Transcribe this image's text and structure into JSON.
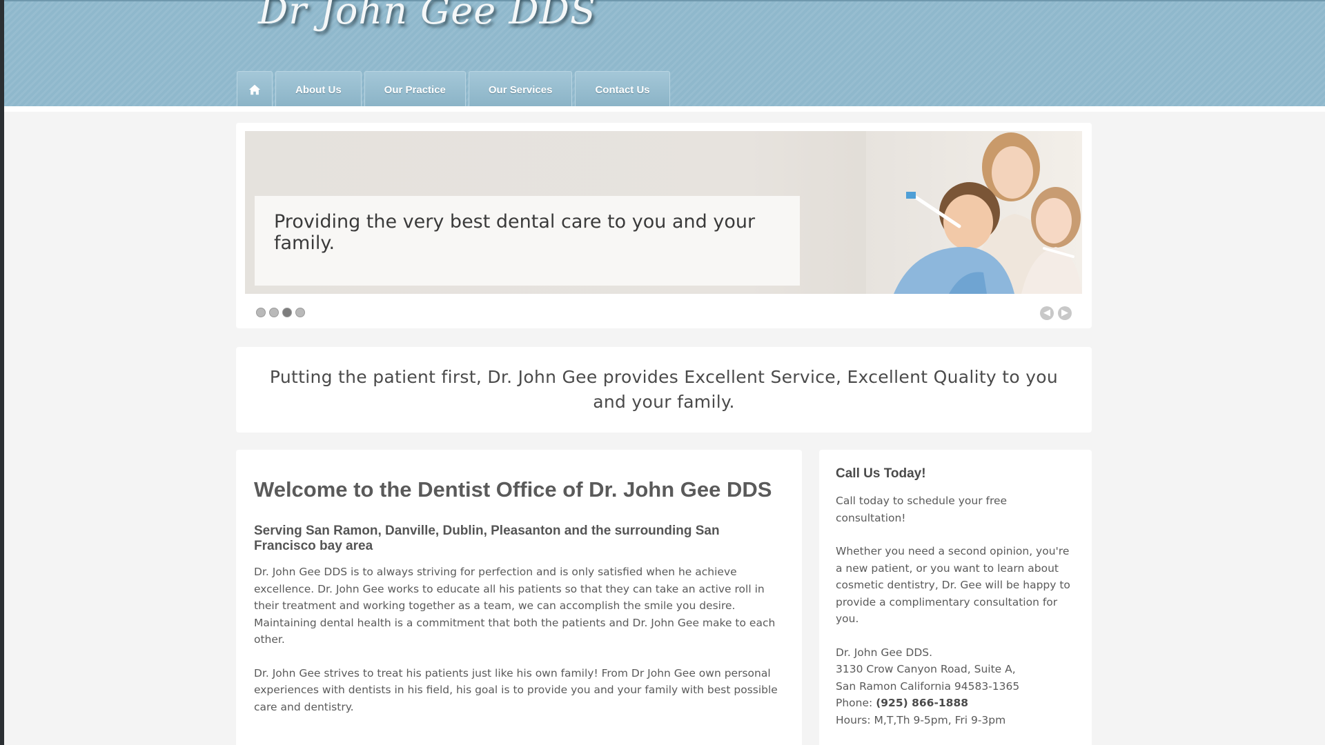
{
  "header": {
    "site_title": "Dr John Gee DDS"
  },
  "nav": {
    "home_icon": "home-icon",
    "items": [
      {
        "label": "About Us"
      },
      {
        "label": "Our Practice"
      },
      {
        "label": "Our Services"
      },
      {
        "label": "Contact Us"
      }
    ]
  },
  "slider": {
    "caption": "Providing the very best dental care to you and your family.",
    "slide_count": 4,
    "active_slide": 3,
    "prev_icon": "arrow-left-icon",
    "next_icon": "arrow-right-icon"
  },
  "tagline": "Putting the patient first, Dr. John Gee provides Excellent Service, Excellent Quality to you and your family.",
  "main": {
    "title": "Welcome to the Dentist Office of Dr. John Gee DDS",
    "subtitle": "Serving San Ramon, Danville, Dublin, Pleasanton and the surrounding San Francisco bay area",
    "paragraphs": [
      "Dr. John Gee DDS is to always striving for perfection and is only satisfied when he achieve excellence. Dr. John Gee works to educate all his patients so that they can take an active roll in their treatment and working together as a team, we can accomplish the smile you desire. Maintaining dental health is a commitment that both the patients and Dr. John Gee make to each other.",
      "Dr. John Gee strives to treat his patients just like his own family! From Dr John Gee own personal experiences with dentists in his field, his goal is to provide you and your family with best possible care and dentistry."
    ]
  },
  "sidebar": {
    "title": "Call Us Today!",
    "intro": "Call today to schedule your free consultation!",
    "body": "Whether you need a second opinion, you're a new patient, or you want to learn about cosmetic dentistry, Dr. Gee will be happy to provide a complimentary consultation for you.",
    "address": {
      "name": "Dr. John Gee DDS.",
      "street": "3130 Crow Canyon Road, Suite A,",
      "city": "San Ramon California 94583-1365",
      "phone_label": "Phone:",
      "phone": "(925) 866-1888",
      "hours": "Hours: M,T,Th 9-5pm, Fri 9-3pm"
    }
  },
  "colors": {
    "header_bg": "#8fb8cc",
    "nav_tab": "#9bc0d2",
    "page_bg": "#f4f4f4",
    "card_bg": "#ffffff"
  }
}
